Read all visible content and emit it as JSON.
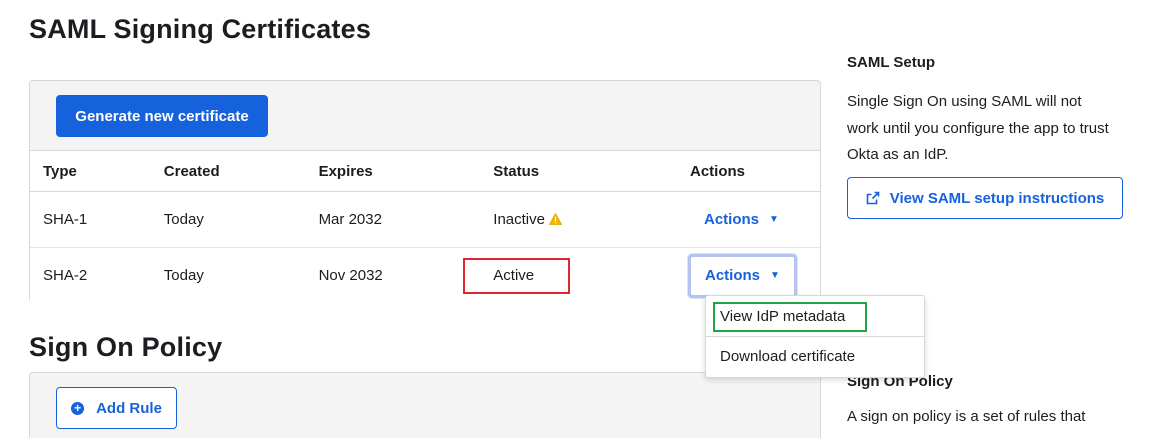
{
  "sections": {
    "certs_title": "SAML Signing Certificates",
    "policy_title": "Sign On Policy"
  },
  "certs": {
    "generate_label": "Generate new certificate",
    "columns": [
      "Type",
      "Created",
      "Expires",
      "Status",
      "Actions"
    ],
    "rows": [
      {
        "type": "SHA-1",
        "created": "Today",
        "expires": "Mar 2032",
        "status": "Inactive",
        "status_icon": "warning-icon",
        "actions": "Actions"
      },
      {
        "type": "SHA-2",
        "created": "Today",
        "expires": "Nov 2032",
        "status": "Active",
        "actions": "Actions"
      }
    ]
  },
  "dropdown": {
    "items": [
      "View IdP metadata",
      "Download certificate"
    ]
  },
  "policy": {
    "add_rule_label": "Add Rule"
  },
  "sidebar": {
    "saml_title": "SAML Setup",
    "saml_text": "Single Sign On using SAML will not work until you configure the app to trust Okta as an IdP.",
    "saml_button": "View SAML setup instructions",
    "policy_title": "Sign On Policy",
    "policy_text": "A sign on policy is a set of rules that"
  },
  "colors": {
    "accent": "#1662dd",
    "warning": "#f5b800",
    "highlight_red": "#e0262e",
    "highlight_green": "#22a345"
  }
}
